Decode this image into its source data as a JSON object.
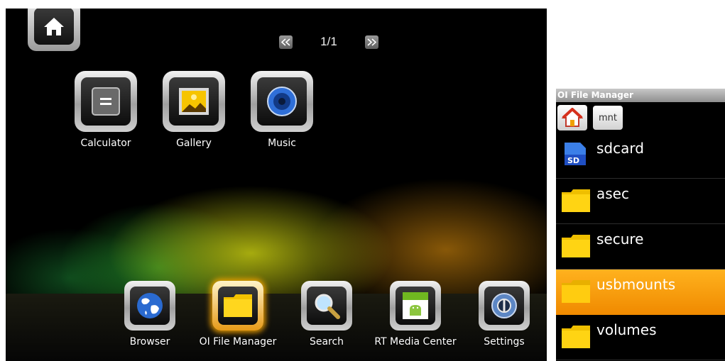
{
  "launcher": {
    "pager": {
      "text": "1/1"
    },
    "top_apps": [
      {
        "label": "Calculator",
        "icon": "calculator-icon"
      },
      {
        "label": "Gallery",
        "icon": "gallery-icon"
      },
      {
        "label": "Music",
        "icon": "music-icon"
      }
    ],
    "dock": [
      {
        "label": "Browser",
        "icon": "globe-icon"
      },
      {
        "label": "OI File Manager",
        "icon": "folder-icon",
        "selected": true
      },
      {
        "label": "Search",
        "icon": "magnifier-icon"
      },
      {
        "label": "RT Media Center",
        "icon": "android-media-icon"
      },
      {
        "label": "Settings",
        "icon": "settings-icon"
      }
    ],
    "accent_color": "#f0a000"
  },
  "file_manager": {
    "title": "OI File Manager",
    "breadcrumb": "mnt",
    "items": [
      {
        "name": "sdcard",
        "icon": "sdcard-icon"
      },
      {
        "name": "asec",
        "icon": "folder-icon"
      },
      {
        "name": "secure",
        "icon": "folder-icon"
      },
      {
        "name": "usbmounts",
        "icon": "folder-icon",
        "selected": true
      },
      {
        "name": "volumes",
        "icon": "folder-icon"
      }
    ],
    "selected_color": "#f59400"
  }
}
